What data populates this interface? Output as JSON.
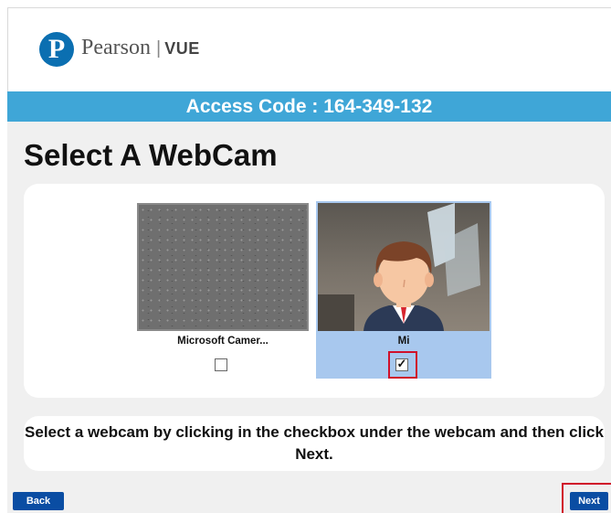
{
  "header": {
    "brand_mark": "P",
    "brand_name": "Pearson",
    "brand_separator": "|",
    "brand_product": "VUE"
  },
  "access_bar": {
    "text": "Access Code : 164-349-132"
  },
  "page": {
    "title": "Select A WebCam"
  },
  "webcams": [
    {
      "name": "Microsoft Camer...",
      "checked": false,
      "check_glyph": ""
    },
    {
      "name": "Mi",
      "checked": true,
      "check_glyph": "✓"
    }
  ],
  "instructions": {
    "text": "Select a webcam by clicking in the checkbox under the webcam and then click Next."
  },
  "buttons": {
    "back_label": "Back",
    "next_label": "Next"
  },
  "colors": {
    "accent_bar": "#3fa6d7",
    "button": "#0a4da3",
    "selected_card": "#a8c8ee",
    "highlight": "#d0102a"
  }
}
